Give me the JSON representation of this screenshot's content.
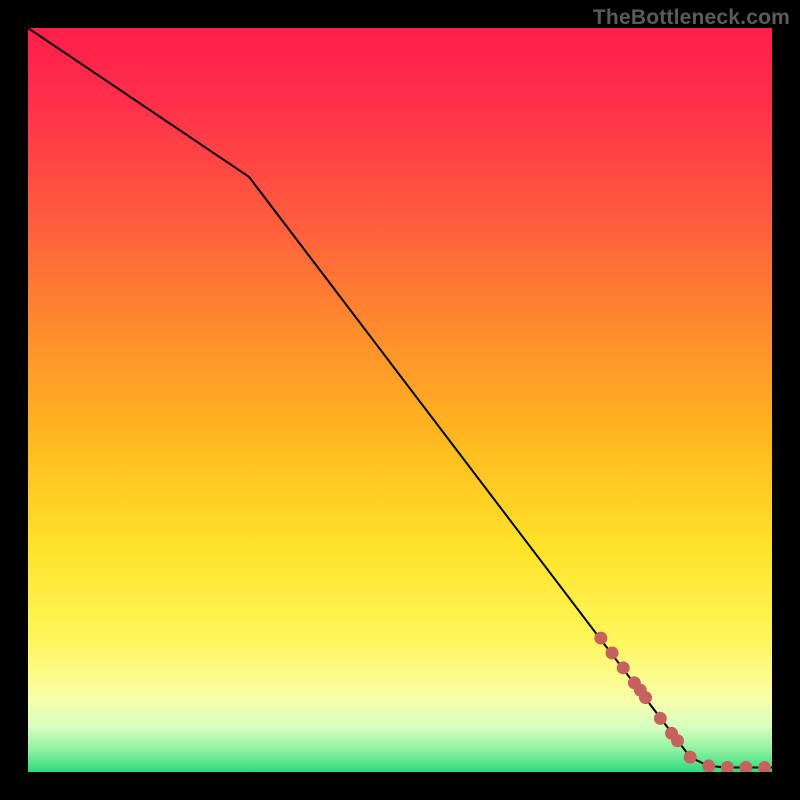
{
  "watermark": "TheBottleneck.com",
  "colors": {
    "gradient_stops": [
      {
        "offset": 0.0,
        "color": "#ff1f4a"
      },
      {
        "offset": 0.1,
        "color": "#ff2f4a"
      },
      {
        "offset": 0.25,
        "color": "#ff5a3f"
      },
      {
        "offset": 0.4,
        "color": "#ff8a2e"
      },
      {
        "offset": 0.55,
        "color": "#ffb81f"
      },
      {
        "offset": 0.7,
        "color": "#ffe32a"
      },
      {
        "offset": 0.82,
        "color": "#fff65a"
      },
      {
        "offset": 0.9,
        "color": "#f9ffa6"
      },
      {
        "offset": 0.94,
        "color": "#d6ffc0"
      },
      {
        "offset": 0.97,
        "color": "#8ff2a0"
      },
      {
        "offset": 1.0,
        "color": "#2fd97e"
      }
    ],
    "frame": "#000000",
    "line": "#000000",
    "marker_fill": "#c6625e",
    "marker_stroke": "#c6625e"
  },
  "chart_data": {
    "type": "line",
    "title": "",
    "xlabel": "",
    "ylabel": "",
    "xlim": [
      0,
      100
    ],
    "ylim": [
      0,
      100
    ],
    "series": [
      {
        "name": "bottleneck-curve",
        "x": [
          0.0,
          29.7,
          89.0,
          91.5,
          94.0,
          96.5,
          99.0,
          100.0
        ],
        "y": [
          100.0,
          80.0,
          2.0,
          0.8,
          0.6,
          0.6,
          0.6,
          0.6
        ]
      }
    ],
    "markers": [
      {
        "x": 77.0,
        "y": 18.0,
        "r": 6
      },
      {
        "x": 78.5,
        "y": 16.0,
        "r": 6
      },
      {
        "x": 80.0,
        "y": 14.0,
        "r": 6
      },
      {
        "x": 81.5,
        "y": 12.0,
        "r": 6
      },
      {
        "x": 82.3,
        "y": 11.0,
        "r": 6
      },
      {
        "x": 83.0,
        "y": 10.0,
        "r": 6
      },
      {
        "x": 85.0,
        "y": 7.2,
        "r": 6
      },
      {
        "x": 86.5,
        "y": 5.2,
        "r": 6
      },
      {
        "x": 87.3,
        "y": 4.2,
        "r": 6
      },
      {
        "x": 89.0,
        "y": 2.0,
        "r": 6
      },
      {
        "x": 91.5,
        "y": 0.8,
        "r": 6
      },
      {
        "x": 94.0,
        "y": 0.6,
        "r": 6
      },
      {
        "x": 96.5,
        "y": 0.6,
        "r": 6
      },
      {
        "x": 99.0,
        "y": 0.6,
        "r": 6
      }
    ]
  }
}
